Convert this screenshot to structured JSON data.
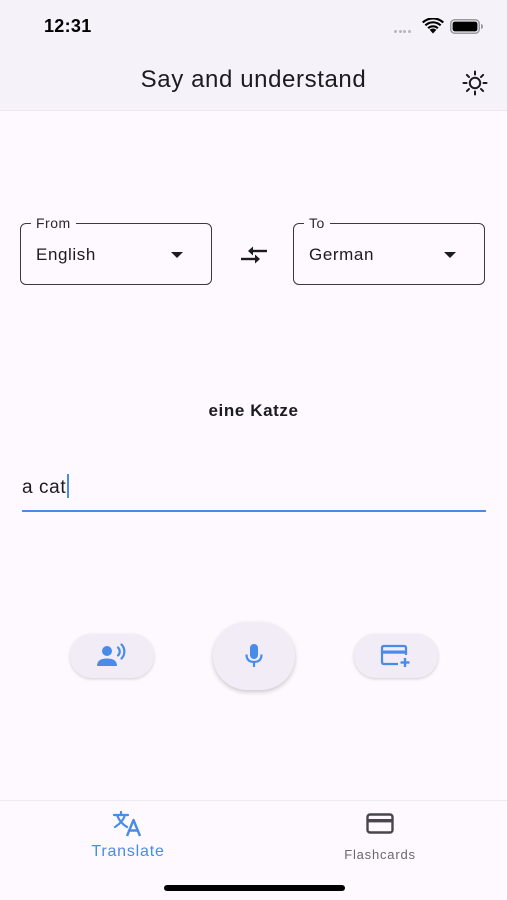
{
  "status_bar": {
    "time": "12:31"
  },
  "app_bar": {
    "title": "Say and understand",
    "theme_icon": "sun-icon"
  },
  "languages": {
    "from": {
      "label": "From",
      "value": "English"
    },
    "to": {
      "label": "To",
      "value": "German"
    },
    "swap_icon": "swap-arrows-icon"
  },
  "translation": {
    "output": "eine Katze",
    "input_value": "a cat"
  },
  "actions": {
    "listen_icon": "speaker-person-icon",
    "mic_icon": "microphone-icon",
    "add_flashcard_icon": "add-card-icon"
  },
  "bottom_nav": {
    "items": [
      {
        "label": "Translate",
        "icon": "translate-icon",
        "active": true
      },
      {
        "label": "Flashcards",
        "icon": "card-icon",
        "active": false
      }
    ]
  },
  "colors": {
    "accent": "#4a8be8",
    "background": "#fdf9fe",
    "app_bar": "#f5f2fa",
    "button_surface": "#f1ecf6"
  }
}
